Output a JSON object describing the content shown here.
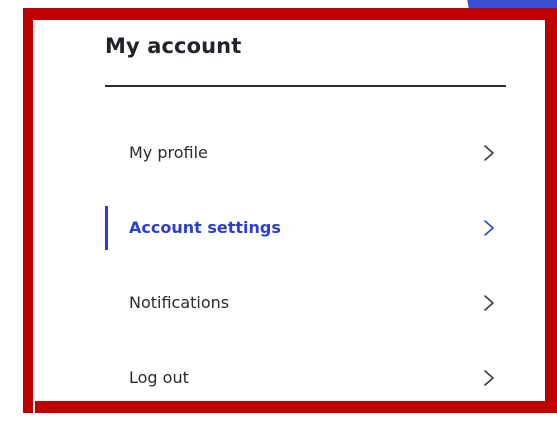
{
  "account_menu": {
    "title": "My account",
    "accent_color": "#2a3fd6",
    "frame_color": "#c00000",
    "items": [
      {
        "label": "My profile",
        "icon": "chevron-right-icon",
        "active": false
      },
      {
        "label": "Account settings",
        "icon": "chevron-right-icon",
        "active": true
      },
      {
        "label": "Notifications",
        "icon": "chevron-right-icon",
        "active": false
      },
      {
        "label": "Log out",
        "icon": "chevron-right-icon",
        "active": false
      }
    ]
  }
}
